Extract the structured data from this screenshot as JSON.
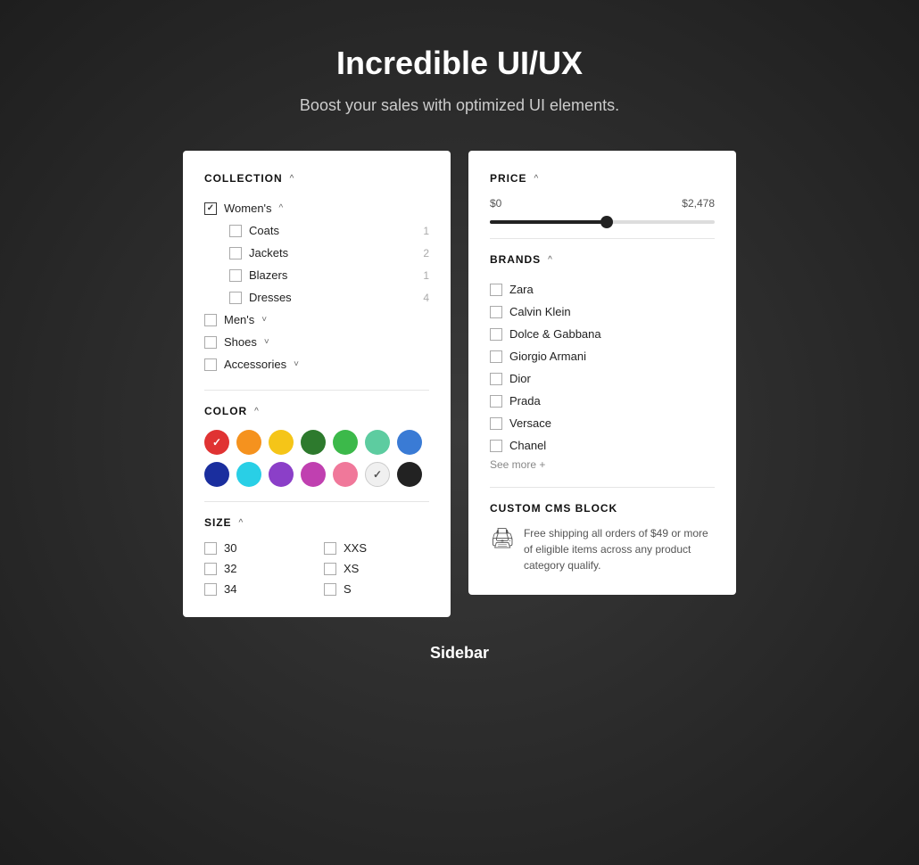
{
  "page": {
    "title": "Incredible UI/UX",
    "subtitle": "Boost your sales with optimized UI elements.",
    "footer_label": "Sidebar"
  },
  "left_panel": {
    "collection": {
      "title": "COLLECTION",
      "caret": "^",
      "womens": {
        "label": "Women's",
        "caret": "^",
        "checked": true,
        "subcategories": [
          {
            "label": "Coats",
            "count": "1"
          },
          {
            "label": "Jackets",
            "count": "2"
          },
          {
            "label": "Blazers",
            "count": "1"
          },
          {
            "label": "Dresses",
            "count": "4"
          }
        ]
      },
      "other_categories": [
        {
          "label": "Men's",
          "caret": "v"
        },
        {
          "label": "Shoes",
          "caret": "v"
        },
        {
          "label": "Accessories",
          "caret": "v"
        }
      ]
    },
    "color": {
      "title": "COLOR",
      "caret": "^",
      "colors": [
        {
          "hex": "#e03333",
          "selected": true,
          "light": false
        },
        {
          "hex": "#f5921e",
          "selected": false,
          "light": false
        },
        {
          "hex": "#f5c518",
          "selected": false,
          "light": false
        },
        {
          "hex": "#2d7a2d",
          "selected": false,
          "light": false
        },
        {
          "hex": "#3cb94a",
          "selected": false,
          "light": false
        },
        {
          "hex": "#5dcca0",
          "selected": false,
          "light": false
        },
        {
          "hex": "#3a7bd5",
          "selected": false,
          "light": false
        },
        {
          "hex": "#1a2e9e",
          "selected": false,
          "light": false
        },
        {
          "hex": "#29cfe6",
          "selected": false,
          "light": false
        },
        {
          "hex": "#8b3fc8",
          "selected": false,
          "light": false
        },
        {
          "hex": "#c040b0",
          "selected": false,
          "light": false
        },
        {
          "hex": "#f0789a",
          "selected": false,
          "light": false
        },
        {
          "hex": "#f0f0f0",
          "selected": true,
          "light": true
        },
        {
          "hex": "#222222",
          "selected": false,
          "light": false
        }
      ]
    },
    "size": {
      "title": "SIZE",
      "caret": "^",
      "items_col1": [
        {
          "label": "30"
        },
        {
          "label": "32"
        },
        {
          "label": "34"
        }
      ],
      "items_col2": [
        {
          "label": "XXS"
        },
        {
          "label": "XS"
        },
        {
          "label": "S"
        }
      ]
    }
  },
  "right_panel": {
    "price": {
      "title": "PRICE",
      "caret": "^",
      "min_label": "$0",
      "max_label": "$2,478",
      "slider_percent": 52
    },
    "brands": {
      "title": "BRANDS",
      "caret": "^",
      "items": [
        {
          "label": "Zara"
        },
        {
          "label": "Calvin Klein"
        },
        {
          "label": "Dolce & Gabbana"
        },
        {
          "label": "Giorgio Armani"
        },
        {
          "label": "Dior"
        },
        {
          "label": "Prada"
        },
        {
          "label": "Versace"
        },
        {
          "label": "Chanel"
        }
      ],
      "see_more": "See more +"
    },
    "cms": {
      "title": "CUSTOM CMS BLOCK",
      "text": "Free shipping all orders of $49 or more of eligible items across any product category qualify."
    }
  }
}
